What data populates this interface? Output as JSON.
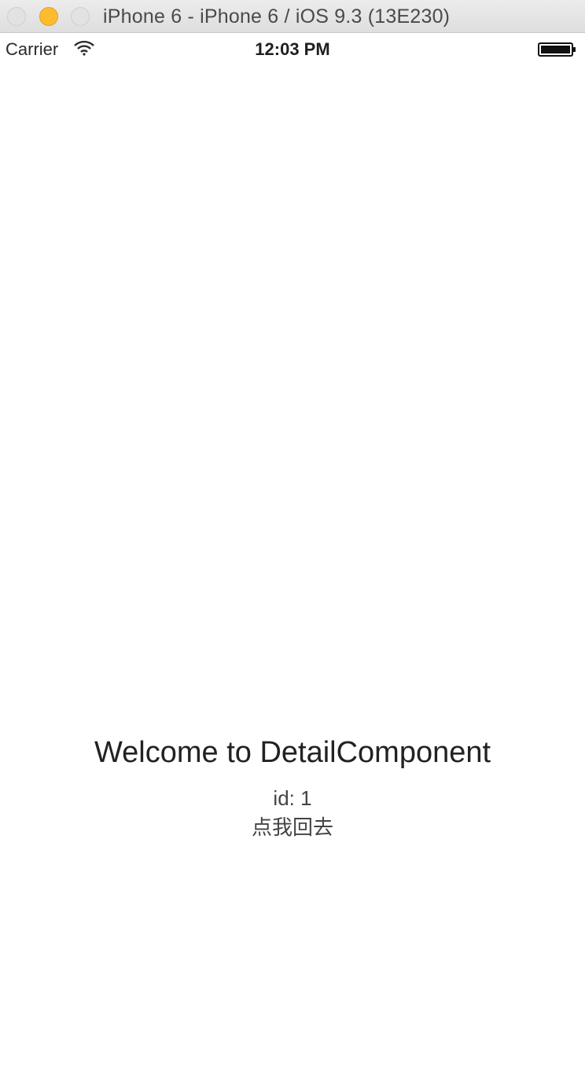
{
  "window": {
    "title": "iPhone 6 - iPhone 6 / iOS 9.3 (13E230)"
  },
  "status_bar": {
    "carrier": "Carrier",
    "time": "12:03 PM"
  },
  "content": {
    "heading": "Welcome to DetailComponent",
    "id_text": "id: 1",
    "back_link": "点我回去"
  },
  "colors": {
    "minimize_button": "#fdbc2e",
    "background": "#ffffff",
    "text": "#222222"
  }
}
